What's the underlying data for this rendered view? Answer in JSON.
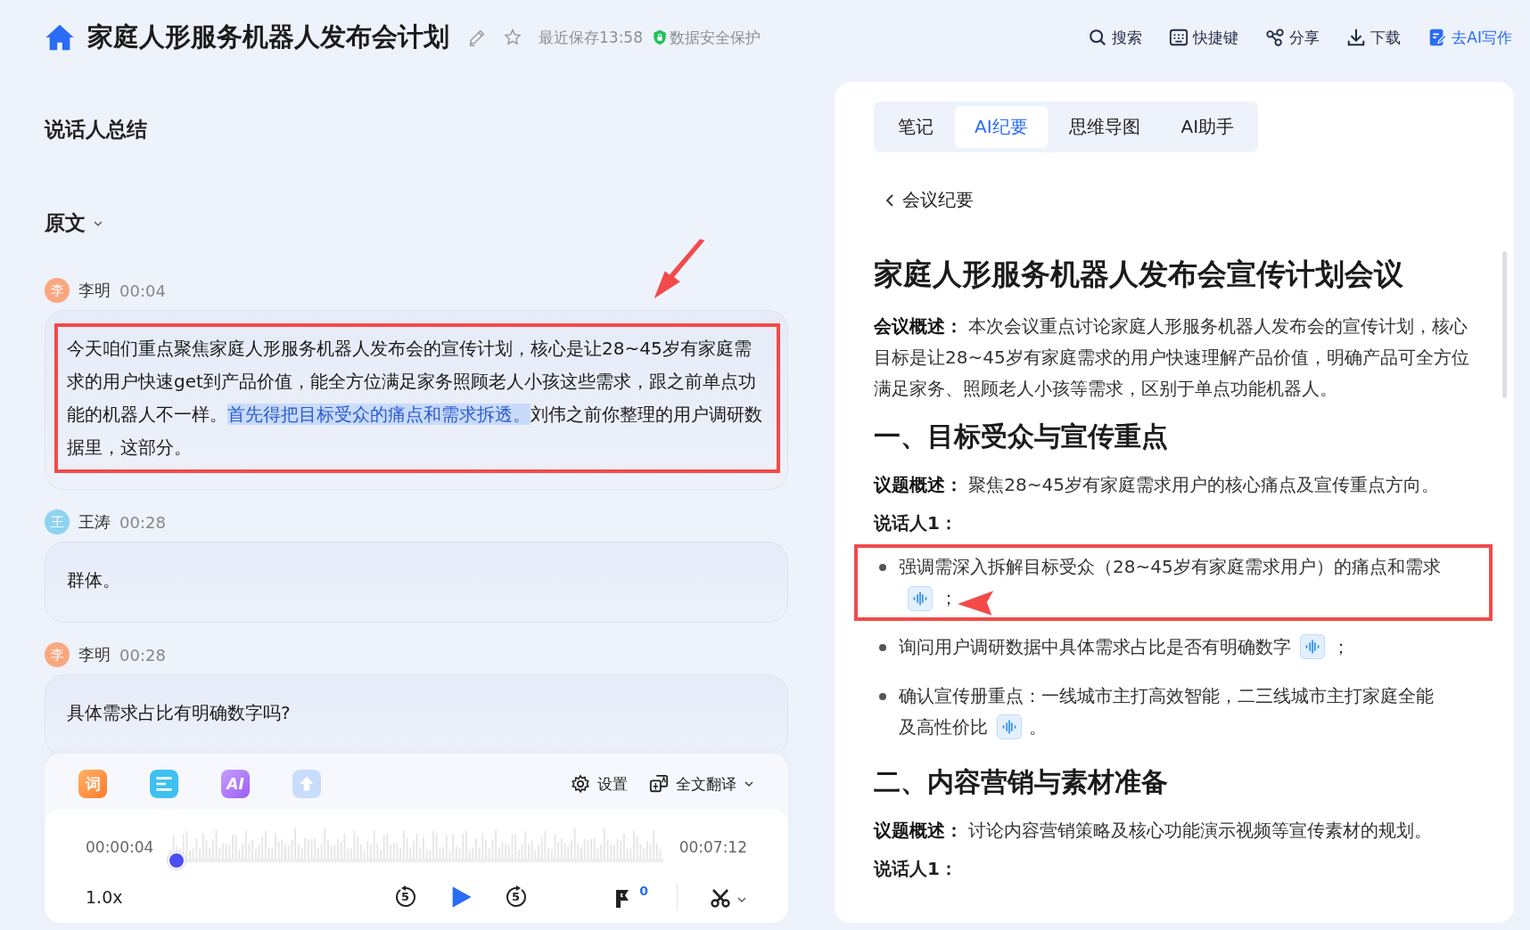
{
  "header": {
    "title": "家庭人形服务机器人发布会计划",
    "saved": "最近保存13:58",
    "security": "数据安全保护",
    "actions": [
      {
        "kind": "search",
        "label": "搜索",
        "accent": false
      },
      {
        "kind": "keyboard",
        "label": "快捷键",
        "accent": false
      },
      {
        "kind": "share",
        "label": "分享",
        "accent": false
      },
      {
        "kind": "download",
        "label": "下载",
        "accent": false
      },
      {
        "kind": "write",
        "label": "去AI写作",
        "accent": true
      }
    ]
  },
  "left": {
    "title": "说话人总结",
    "section": "原文",
    "segments": [
      {
        "avatar": "李",
        "speaker": "李明",
        "time": "00:04",
        "color": "#f9a77f",
        "highlighted": true,
        "parts": [
          {
            "text": "今天咱们重点聚焦家庭人形服务机器人发布会的宣传计划，核心是让28~45岁有家庭需求的用户快速get到产品价值，能全方位满足家务照顾老人小孩这些需求，跟之前单点功能的机器人不一样。",
            "selected": false
          },
          {
            "text": "首先得把目标受众的痛点和需求拆透。",
            "selected": true
          },
          {
            "text": "刘伟之前你整理的用户调研数据里，这部分。",
            "selected": false
          }
        ]
      },
      {
        "avatar": "王",
        "speaker": "王涛",
        "time": "00:28",
        "color": "#8fd3f0",
        "highlighted": false,
        "parts": [
          {
            "text": "群体。",
            "selected": false
          }
        ]
      },
      {
        "avatar": "李",
        "speaker": "李明",
        "time": "00:28",
        "color": "#f9a77f",
        "highlighted": false,
        "parts": [
          {
            "text": "具体需求占比有明确数字吗?",
            "selected": false
          }
        ]
      }
    ]
  },
  "player": {
    "tools": [
      {
        "kind": "word",
        "label": "词"
      },
      {
        "kind": "list"
      },
      {
        "kind": "ai",
        "label": "AI"
      },
      {
        "kind": "upload"
      }
    ],
    "settings": "设置",
    "translate": "全文翻译",
    "current": "00:00:04",
    "total": "00:07:12",
    "level": 0.01,
    "speed": "1.0x",
    "rewind": "5",
    "forward": "5",
    "flags": "0"
  },
  "panel": {
    "tabs": [
      {
        "label": "笔记",
        "selected": false
      },
      {
        "label": "AI纪要",
        "selected": true
      },
      {
        "label": "思维导图",
        "selected": false
      },
      {
        "label": "AI助手",
        "selected": false
      }
    ],
    "back": "会议纪要",
    "title": "家庭人形服务机器人发布会宣传计划会议",
    "blocks": [
      {
        "kind": "paragraph",
        "text": "**会议概述：** 本次会议重点讨论家庭人形服务机器人发布会的宣传计划，核心目标是让28~45岁有家庭需求的用户快速理解产品价值，明确产品可全方位满足家务、照顾老人小孩等需求，区别于单点功能机器人。"
      },
      {
        "kind": "heading",
        "text": "一、目标受众与宣传重点"
      },
      {
        "kind": "paragraph",
        "text": "**议题概述：** 聚焦28~45岁有家庭需求用户的核心痛点及宣传重点方向。"
      },
      {
        "kind": "label",
        "text": "说话人1："
      },
      {
        "kind": "bullet",
        "text": "强调需深入拆解目标受众（28~45岁有家庭需求用户）的痛点和需求",
        "tail": "；",
        "highlighted": true
      },
      {
        "kind": "bullet",
        "text": "询问用户调研数据中具体需求占比是否有明确数字",
        "tail": "；",
        "highlighted": false
      },
      {
        "kind": "bullet",
        "text": "确认宣传册重点：一线城市主打高效智能，二三线城市主打家庭全能及高性价比",
        "tail": "。",
        "highlighted": false
      },
      {
        "kind": "heading",
        "text": "二、内容营销与素材准备"
      },
      {
        "kind": "paragraph",
        "text": "**议题概述：** 讨论内容营销策略及核心功能演示视频等宣传素材的规划。"
      },
      {
        "kind": "label",
        "text": "说话人1："
      }
    ]
  }
}
